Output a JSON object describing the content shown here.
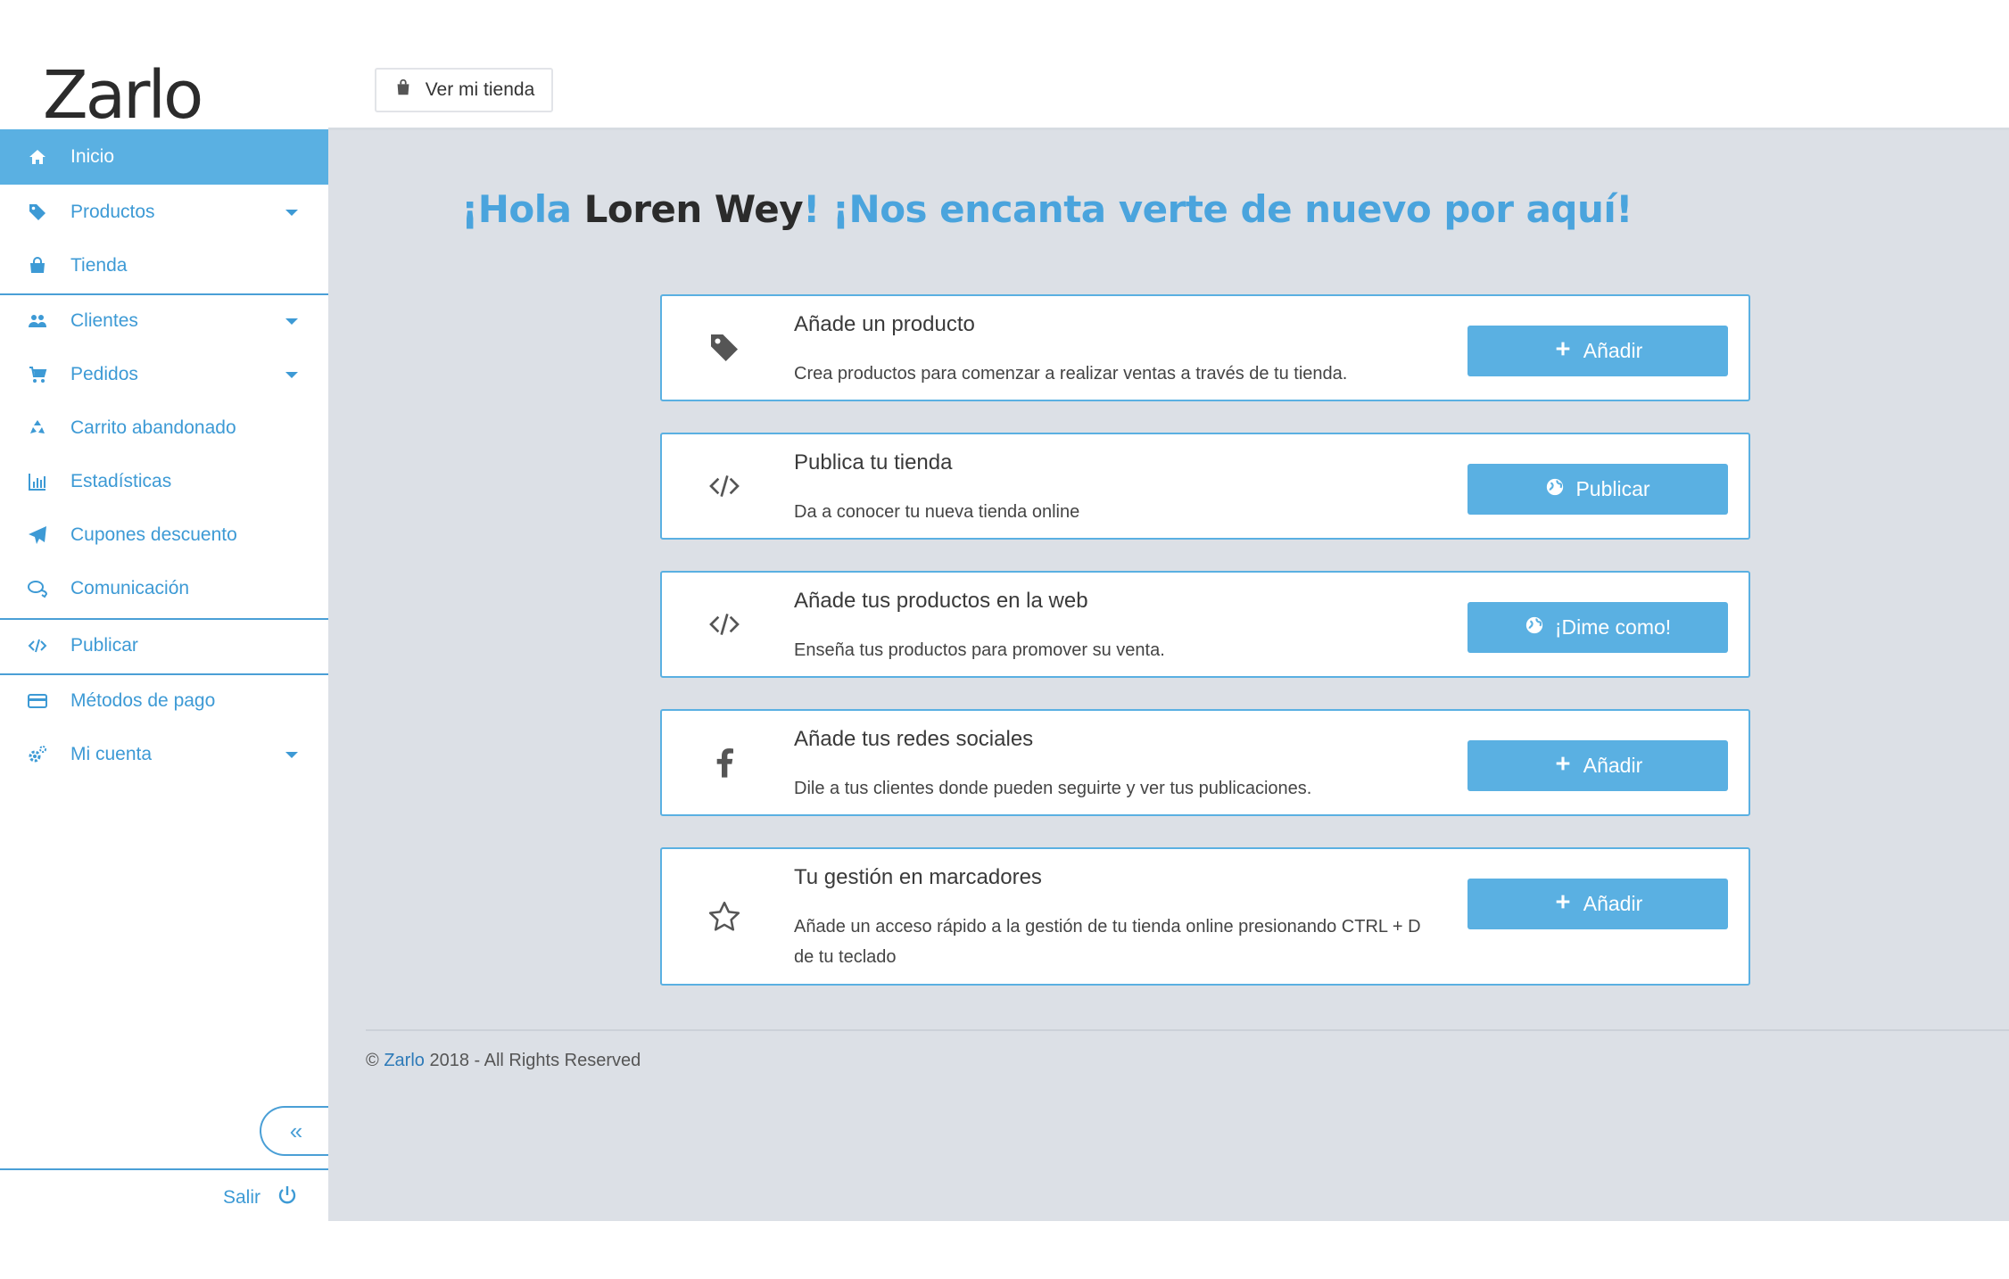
{
  "header": {
    "logo_text": "Zarlo",
    "store_button": "Ver mi tienda"
  },
  "sidebar": {
    "items": [
      {
        "label": "Inicio",
        "icon": "home-icon",
        "active": true
      },
      {
        "label": "Productos",
        "icon": "tag-icon",
        "dropdown": true
      },
      {
        "label": "Tienda",
        "icon": "bag-icon"
      },
      {
        "label": "Clientes",
        "icon": "users-icon",
        "dropdown": true
      },
      {
        "label": "Pedidos",
        "icon": "cart-icon",
        "dropdown": true
      },
      {
        "label": "Carrito abandonado",
        "icon": "recycle-icon"
      },
      {
        "label": "Estadísticas",
        "icon": "bar-chart-icon"
      },
      {
        "label": "Cupones descuento",
        "icon": "paper-plane-icon"
      },
      {
        "label": "Comunicación",
        "icon": "chat-icon"
      },
      {
        "label": "Publicar",
        "icon": "code-icon"
      },
      {
        "label": "Métodos de pago",
        "icon": "credit-card-icon"
      },
      {
        "label": "Mi cuenta",
        "icon": "gears-icon",
        "dropdown": true
      }
    ],
    "collapse_label": "«",
    "logout_label": "Salir"
  },
  "greeting": {
    "prefix": "¡Hola ",
    "name": "Loren Wey",
    "suffix": "! ¡Nos encanta verte de nuevo por aquí!"
  },
  "cards": [
    {
      "title": "Añade un producto",
      "description": "Crea productos para comenzar a realizar ventas a través de tu tienda.",
      "icon": "tag-icon",
      "button": "Añadir",
      "button_icon": "plus-icon"
    },
    {
      "title": "Publica tu tienda",
      "description": "Da a conocer tu nueva tienda online",
      "icon": "code-icon",
      "button": "Publicar",
      "button_icon": "globe-icon"
    },
    {
      "title": "Añade tus productos en la web",
      "description": "Enseña tus productos para promover su venta.",
      "icon": "code-icon",
      "button": "¡Dime como!",
      "button_icon": "globe-icon"
    },
    {
      "title": "Añade tus redes sociales",
      "description": "Dile a tus clientes donde pueden seguirte y ver tus publicaciones.",
      "icon": "facebook-icon",
      "button": "Añadir",
      "button_icon": "plus-icon"
    },
    {
      "title": "Tu gestión en marcadores",
      "description": "Añade un acceso rápido a la gestión de tu tienda online presionando CTRL + D de tu teclado",
      "icon": "star-icon",
      "button": "Añadir",
      "button_icon": "plus-icon"
    }
  ],
  "footer": {
    "copyright": "©",
    "brand": "Zarlo",
    "rest": "2018 - All Rights Reserved"
  },
  "colors": {
    "accent": "#5ab0e2",
    "link": "#3d9ad5",
    "main_bg": "#dce0e6"
  }
}
